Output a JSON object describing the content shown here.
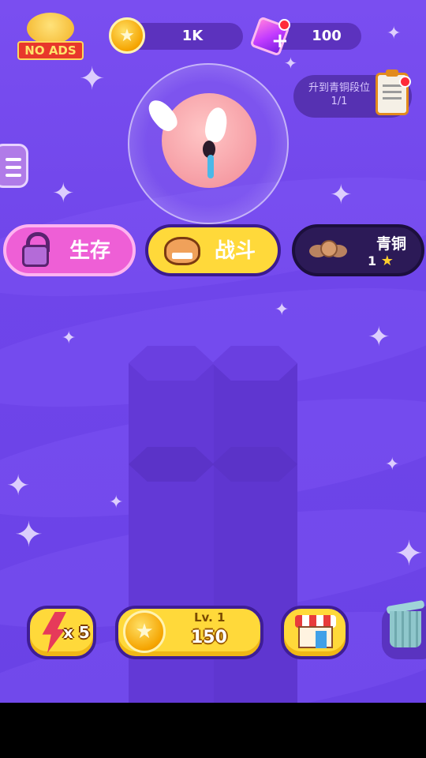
{
  "header": {
    "no_ads_label": "NO ADS",
    "coins": "1K",
    "gems": "100",
    "task_text": "升到青铜段位 1/1"
  },
  "modes": {
    "survival_label": "生存",
    "battle_label": "战斗",
    "rank_name": "青铜",
    "rank_stars": "1"
  },
  "controls": {
    "energy_count": "x 5",
    "upgrade_level": "Lv. 1",
    "upgrade_cost": "150"
  },
  "icons": [
    "no-ads-icon",
    "coin-icon",
    "gem-icon",
    "clipboard-icon",
    "menu-icon",
    "lock-icon",
    "dragon-icon",
    "bronze-medal-icon",
    "lightning-icon",
    "shop-icon",
    "trash-icon"
  ],
  "colors": {
    "background": "#6f45ea",
    "survival_button": "#ee5fd6",
    "battle_button": "#ffd93a",
    "rank_button": "#2c1a57",
    "accent_yellow": "#ffd93a"
  }
}
